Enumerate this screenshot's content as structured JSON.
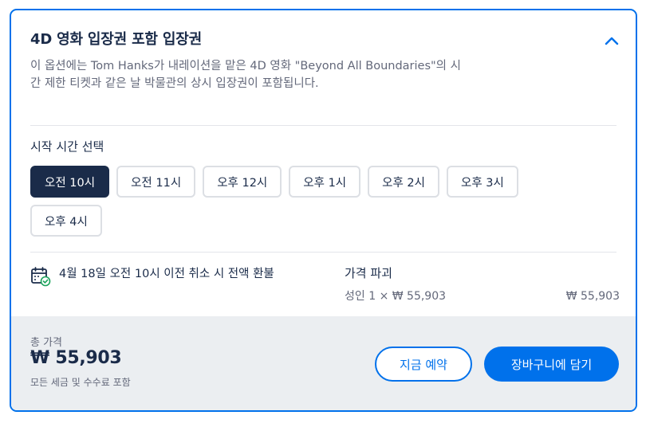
{
  "option": {
    "title": "4D 영화 입장권 포함 입장권",
    "collapse_icon": "chevron-up-icon",
    "description": "이 옵션에는 Tom Hanks가 내레이션을 맡은 4D 영화 \"Beyond All Boundaries\"의 시간 제한 티켓과 같은 날 박물관의 상시 입장권이 포함됩니다."
  },
  "start_time": {
    "label": "시작 시간 선택",
    "selected_index": 0,
    "options": [
      "오전 10시",
      "오전 11시",
      "오후 12시",
      "오후 1시",
      "오후 2시",
      "오후 3시",
      "오후 4시"
    ]
  },
  "cancellation": {
    "icon": "calendar-check-icon",
    "text": "4월 18일 오전 10시 이전 취소 시 전액 환불"
  },
  "price_breakdown": {
    "title": "가격 파괴",
    "rows": [
      {
        "label": "성인 1 × ₩ 55,903",
        "amount": "₩ 55,903"
      }
    ]
  },
  "footer": {
    "total_label": "총 가격",
    "total_value": "₩ 55,903",
    "total_note": "모든 세금 및 수수료 포함",
    "reserve_label": "지금 예약",
    "cart_label": "장바구니에 담기"
  },
  "colors": {
    "accent": "#0071eb",
    "navy": "#1a2b49",
    "muted": "#63687a",
    "footer_bg": "#ebeef1"
  }
}
